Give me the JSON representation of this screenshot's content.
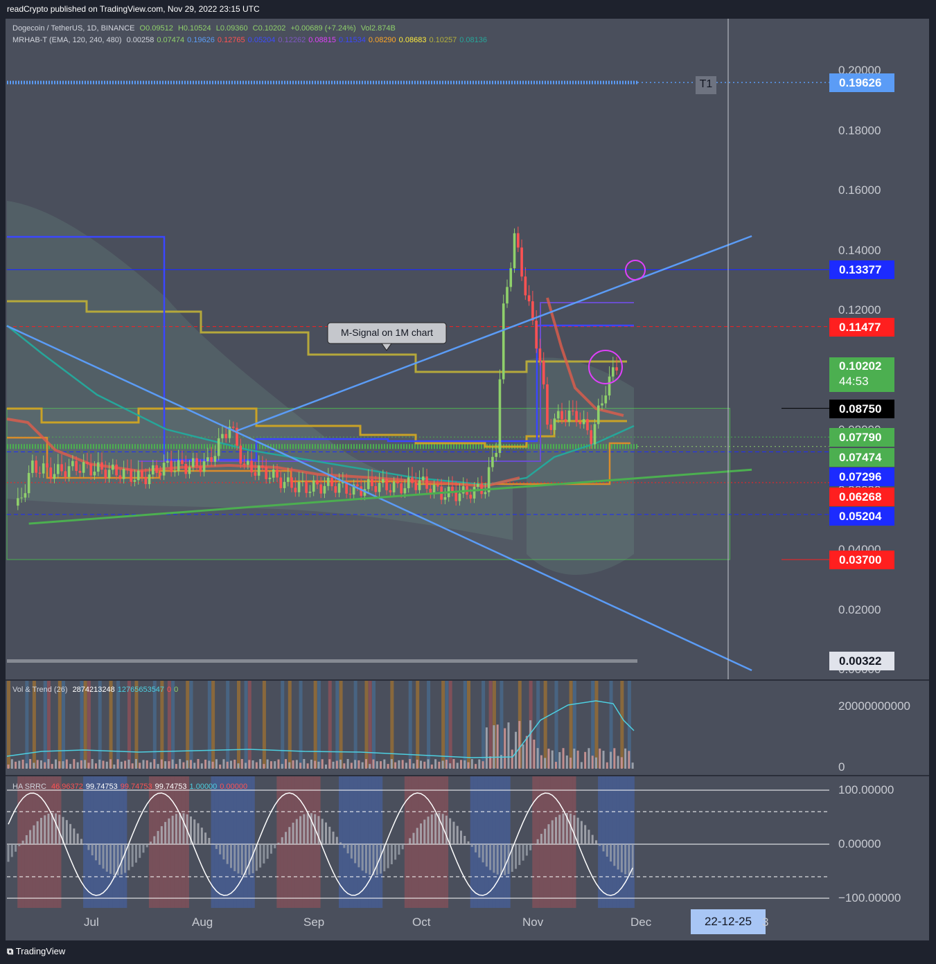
{
  "header": {
    "publisher_line": "readCrypto published on TradingView.com, Nov 29, 2022 23:15 UTC"
  },
  "legend_main": {
    "symbol": "Dogecoin / TetherUS, 1D, BINANCE",
    "ohlc": [
      "O0.09512",
      "H0.10524",
      "L0.09360",
      "C0.10202",
      "+0.00689 (+7.24%)"
    ],
    "volume": "Vol2.874B"
  },
  "legend_indicator": {
    "name": "MRHAB-T (EMA, 120, 240, 480)",
    "values": [
      {
        "text": "0.00258",
        "color": "#d1d4dc"
      },
      {
        "text": "0.07474",
        "color": "#8fd06b"
      },
      {
        "text": "0.19626",
        "color": "#5b9cf6"
      },
      {
        "text": "0.12765",
        "color": "#ff5252"
      },
      {
        "text": "0.05204",
        "color": "#3c4cff"
      },
      {
        "text": "0.12262",
        "color": "#7e57c2"
      },
      {
        "text": "0.08815",
        "color": "#e040fb"
      },
      {
        "text": "0.11534",
        "color": "#3a47ff"
      },
      {
        "text": "0.08290",
        "color": "#ffa726"
      },
      {
        "text": "0.08683",
        "color": "#ffeb3b"
      },
      {
        "text": "0.10257",
        "color": "#b5b23b"
      },
      {
        "text": "0.08136",
        "color": "#26a69a"
      }
    ]
  },
  "legend_volume": {
    "name": "Vol & Trend (26)",
    "values": [
      {
        "text": "2874213248",
        "color": "#ffffff"
      },
      {
        "text": "12765653547",
        "color": "#4dd0e1"
      },
      {
        "text": "0",
        "color": "#ff5252"
      },
      {
        "text": "0",
        "color": "#8fd06b"
      }
    ]
  },
  "legend_srrc": {
    "name": "HA SRRC",
    "values": [
      {
        "text": "46.96372",
        "color": "#ff5252"
      },
      {
        "text": "99.74753",
        "color": "#ffffff"
      },
      {
        "text": "99.74753",
        "color": "#ff5252"
      },
      {
        "text": "99.74753",
        "color": "#ffffff"
      },
      {
        "text": "1.00000",
        "color": "#4dd0e1"
      },
      {
        "text": "0.00000",
        "color": "#ff5252"
      }
    ]
  },
  "price_axis": {
    "ticks": [
      "0.20000",
      "0.18000",
      "0.16000",
      "0.14000",
      "0.12000",
      "0.10000",
      "0.08000",
      "0.06000",
      "0.04000",
      "0.02000",
      "0.00000"
    ],
    "tags": [
      {
        "value": "0.19626",
        "bg": "#5b9cf6",
        "fg": "#ffffff"
      },
      {
        "value": "0.13377",
        "bg": "#1c2bff",
        "fg": "#ffffff"
      },
      {
        "value": "0.11477",
        "bg": "#ff1f1f",
        "fg": "#ffffff"
      },
      {
        "value": "0.08750",
        "bg": "#000000",
        "fg": "#ffffff"
      },
      {
        "value": "0.07790",
        "bg": "#4caf50",
        "fg": "#ffffff"
      },
      {
        "value": "0.07474",
        "bg": "#4caf50",
        "fg": "#ffffff"
      },
      {
        "value": "0.07296",
        "bg": "#1c2bff",
        "fg": "#ffffff"
      },
      {
        "value": "0.06268",
        "bg": "#ff1f1f",
        "fg": "#ffffff"
      },
      {
        "value": "0.05204",
        "bg": "#1c2bff",
        "fg": "#ffffff"
      },
      {
        "value": "0.03700",
        "bg": "#ff1f1f",
        "fg": "#ffffff"
      },
      {
        "value": "0.00322",
        "bg": "#e0e3eb",
        "fg": "#131722"
      }
    ],
    "current_price": {
      "value": "0.10202",
      "countdown": "44:53",
      "bg": "#4caf50"
    }
  },
  "volume_axis": {
    "ticks": [
      "20000000000",
      "0"
    ]
  },
  "srrc_axis": {
    "ticks": [
      "100.00000",
      "0.00000",
      "−100.00000"
    ]
  },
  "time_axis": {
    "months": [
      "Jul",
      "Aug",
      "Sep",
      "Oct",
      "Nov",
      "Dec"
    ],
    "cursor_date": "22-12-25",
    "cursor_trailing": "3"
  },
  "annotations": {
    "callout": "M-Signal on 1M chart",
    "target_label": "T1"
  },
  "footer": {
    "brand": "TradingView"
  },
  "chart_data": {
    "type": "candlestick",
    "symbol": "Dogecoin / TetherUS",
    "interval": "1D",
    "exchange": "BINANCE",
    "x_range": [
      "2022-06-15",
      "2023-01-05"
    ],
    "ylim": [
      0.0,
      0.21
    ],
    "last": {
      "open": 0.09512,
      "high": 0.10524,
      "low": 0.0936,
      "close": 0.10202,
      "change": 0.00689,
      "change_pct": 7.24
    },
    "close_series": [
      {
        "date": "2022-06-18",
        "close": 0.055
      },
      {
        "date": "2022-06-22",
        "close": 0.068
      },
      {
        "date": "2022-06-28",
        "close": 0.066
      },
      {
        "date": "2022-07-04",
        "close": 0.068
      },
      {
        "date": "2022-07-10",
        "close": 0.067
      },
      {
        "date": "2022-07-16",
        "close": 0.066
      },
      {
        "date": "2022-07-22",
        "close": 0.064
      },
      {
        "date": "2022-07-28",
        "close": 0.068
      },
      {
        "date": "2022-08-03",
        "close": 0.068
      },
      {
        "date": "2022-08-09",
        "close": 0.069
      },
      {
        "date": "2022-08-15",
        "close": 0.082
      },
      {
        "date": "2022-08-19",
        "close": 0.068
      },
      {
        "date": "2022-08-25",
        "close": 0.066
      },
      {
        "date": "2022-08-31",
        "close": 0.062
      },
      {
        "date": "2022-09-06",
        "close": 0.061
      },
      {
        "date": "2022-09-12",
        "close": 0.062
      },
      {
        "date": "2022-09-18",
        "close": 0.06
      },
      {
        "date": "2022-09-24",
        "close": 0.062
      },
      {
        "date": "2022-09-30",
        "close": 0.061
      },
      {
        "date": "2022-10-06",
        "close": 0.063
      },
      {
        "date": "2022-10-12",
        "close": 0.059
      },
      {
        "date": "2022-10-18",
        "close": 0.059
      },
      {
        "date": "2022-10-24",
        "close": 0.061
      },
      {
        "date": "2022-10-27",
        "close": 0.075
      },
      {
        "date": "2022-10-29",
        "close": 0.12
      },
      {
        "date": "2022-11-01",
        "close": 0.145
      },
      {
        "date": "2022-11-04",
        "close": 0.127
      },
      {
        "date": "2022-11-08",
        "close": 0.104
      },
      {
        "date": "2022-11-10",
        "close": 0.082
      },
      {
        "date": "2022-11-14",
        "close": 0.085
      },
      {
        "date": "2022-11-18",
        "close": 0.085
      },
      {
        "date": "2022-11-22",
        "close": 0.078
      },
      {
        "date": "2022-11-26",
        "close": 0.094
      },
      {
        "date": "2022-11-29",
        "close": 0.10202
      }
    ],
    "horizontal_levels": [
      {
        "value": 0.19626,
        "color": "#5b9cf6"
      },
      {
        "value": 0.13377,
        "color": "#1c2bff"
      },
      {
        "value": 0.11477,
        "color": "#ff1f1f"
      },
      {
        "value": 0.0875,
        "color": "#000000"
      },
      {
        "value": 0.0779,
        "color": "#4caf50"
      },
      {
        "value": 0.07474,
        "color": "#4caf50"
      },
      {
        "value": 0.07296,
        "color": "#1c2bff"
      },
      {
        "value": 0.06268,
        "color": "#ff1f1f"
      },
      {
        "value": 0.05204,
        "color": "#1c2bff"
      },
      {
        "value": 0.037,
        "color": "#ff1f1f"
      },
      {
        "value": 0.00322,
        "color": "#e0e3eb"
      }
    ],
    "trendlines": [
      {
        "color": "#5b9cf6",
        "from": {
          "date": "2022-06-15",
          "price": 0.115
        },
        "to": {
          "date": "2023-01-05",
          "price": 0.0
        }
      },
      {
        "color": "#5b9cf6",
        "from": {
          "date": "2022-08-17",
          "price": 0.08
        },
        "to": {
          "date": "2023-01-05",
          "price": 0.145
        }
      },
      {
        "color": "#4caf50",
        "from": {
          "date": "2022-06-21",
          "price": 0.049
        },
        "to": {
          "date": "2023-01-05",
          "price": 0.067
        }
      }
    ],
    "range_box": {
      "top": 0.0875,
      "bottom": 0.037,
      "from": "2022-06-15",
      "to": "2022-12-30",
      "color": "#4caf50"
    }
  }
}
